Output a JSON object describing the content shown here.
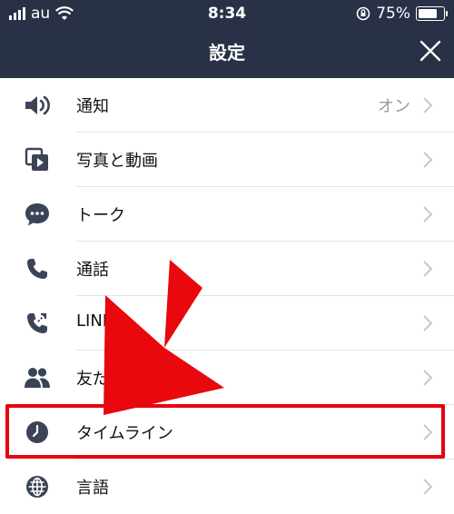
{
  "status_bar": {
    "carrier": "au",
    "time": "8:34",
    "battery_percent": "75%",
    "battery_level": 0.75
  },
  "header": {
    "title": "設定",
    "close_icon": "close-icon"
  },
  "settings": {
    "items": [
      {
        "label": "通知",
        "value": "オン",
        "icon": "speaker-icon"
      },
      {
        "label": "写真と動画",
        "value": "",
        "icon": "media-icon"
      },
      {
        "label": "トーク",
        "value": "",
        "icon": "chat-bubble-icon"
      },
      {
        "label": "通話",
        "value": "",
        "icon": "phone-icon"
      },
      {
        "label": "LINE O",
        "value": "",
        "icon": "phone-out-icon"
      },
      {
        "label": "友だ",
        "value": "",
        "icon": "friends-icon"
      },
      {
        "label": "タイムライン",
        "value": "",
        "icon": "clock-icon"
      },
      {
        "label": "言語",
        "value": "",
        "icon": "globe-icon"
      }
    ]
  },
  "colors": {
    "header_bg": "#283146",
    "highlight": "#e60012",
    "icon": "#3b4357"
  }
}
